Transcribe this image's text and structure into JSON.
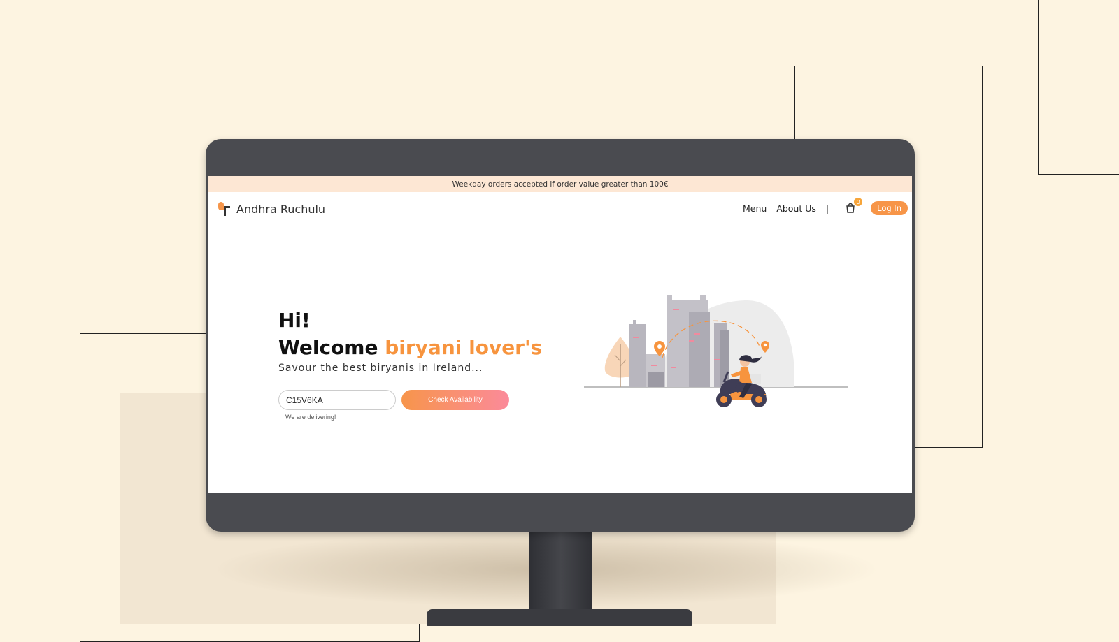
{
  "promo": {
    "text": "Weekday orders accepted if order value greater than 100€"
  },
  "brand": {
    "name": "Andhra Ruchulu",
    "accent_color": "#f7943e"
  },
  "nav": {
    "menu_label": "Menu",
    "about_label": "About Us",
    "separator": "|",
    "cart_icon": "cart-icon",
    "cart_count": "0",
    "login_label": "Log In"
  },
  "hero": {
    "greeting": "Hi!",
    "welcome_prefix": "Welcome",
    "welcome_accent": "biryani lover's",
    "subtitle": "Savour the best biryanis in Ireland..."
  },
  "availability": {
    "input_value": "C15V6KA",
    "button_label": "Check Availability",
    "status_text": "We are delivering!"
  },
  "illustration": {
    "icon": "delivery-scooter-illustration"
  }
}
